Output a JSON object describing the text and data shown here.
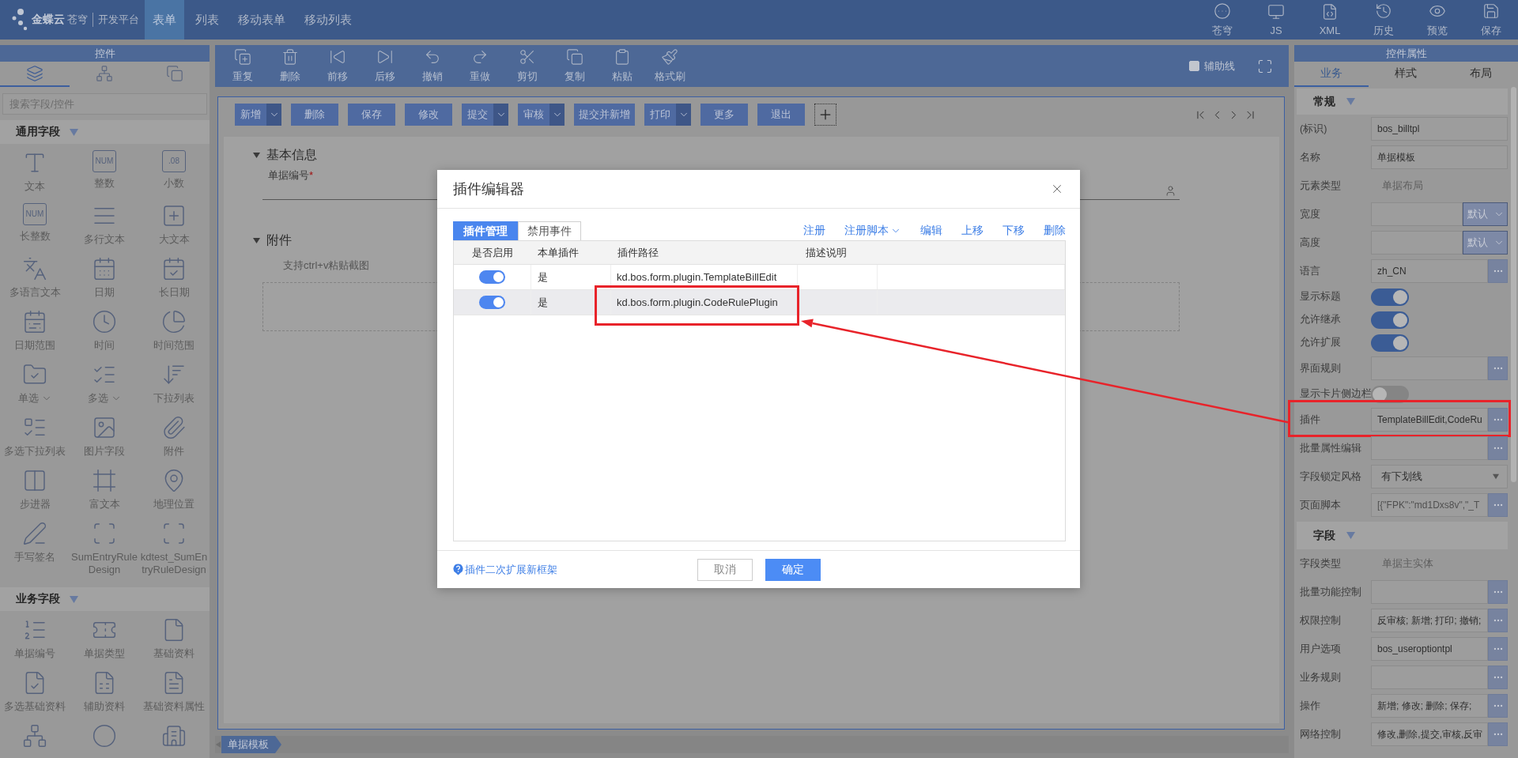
{
  "header": {
    "logo": {
      "brand": "金蝶云",
      "product": "苍穹",
      "platform": "开发平台"
    },
    "tabs": [
      {
        "label": "表单",
        "selected": true
      },
      {
        "label": "列表",
        "selected": false
      },
      {
        "label": "移动表单",
        "selected": false
      },
      {
        "label": "移动列表",
        "selected": false
      }
    ],
    "actions": [
      {
        "label": "苍穹"
      },
      {
        "label": "JS"
      },
      {
        "label": "XML"
      },
      {
        "label": "历史"
      },
      {
        "label": "预览"
      },
      {
        "label": "保存"
      }
    ]
  },
  "controls_panel": {
    "title": "控件",
    "view_tabs": [
      {
        "selected": true
      },
      {
        "selected": false
      },
      {
        "selected": false
      }
    ],
    "search": {
      "placeholder": "搜索字段/控件"
    },
    "groups": [
      {
        "title": "通用字段",
        "expanded": true,
        "items": [
          {
            "label": "文本",
            "dropdown": false
          },
          {
            "label": "整数",
            "icon_text": "NUM",
            "dropdown": false
          },
          {
            "label": "小数",
            "icon_text": ".08",
            "dropdown": false
          },
          {
            "label": "长整数",
            "icon_text": "NUM",
            "dropdown": false
          },
          {
            "label": "多行文本",
            "dropdown": false
          },
          {
            "label": "大文本",
            "dropdown": false
          },
          {
            "label": "多语言文本",
            "dropdown": false
          },
          {
            "label": "日期",
            "dropdown": false
          },
          {
            "label": "长日期",
            "dropdown": false
          },
          {
            "label": "日期范围",
            "dropdown": false
          },
          {
            "label": "时间",
            "dropdown": false
          },
          {
            "label": "时间范围",
            "dropdown": false
          },
          {
            "label": "单选",
            "dropdown": true
          },
          {
            "label": "多选",
            "dropdown": true
          },
          {
            "label": "下拉列表",
            "dropdown": false
          },
          {
            "label": "多选下拉列表",
            "dropdown": false
          },
          {
            "label": "图片字段",
            "dropdown": false
          },
          {
            "label": "附件",
            "dropdown": false
          },
          {
            "label": "步进器",
            "dropdown": false
          },
          {
            "label": "富文本",
            "dropdown": false
          },
          {
            "label": "地理位置",
            "dropdown": false
          },
          {
            "label": "手写签名",
            "dropdown": false
          },
          {
            "label": "SumEntryRuleDesign",
            "dropdown": false
          },
          {
            "label": "kdtest_SumEntryRuleDesign",
            "dropdown": false
          }
        ]
      },
      {
        "title": "业务字段",
        "expanded": true,
        "items": [
          {
            "label": "单据编号",
            "dropdown": false
          },
          {
            "label": "单据类型",
            "dropdown": false
          },
          {
            "label": "基础资料",
            "dropdown": false
          },
          {
            "label": "多选基础资料",
            "dropdown": false
          },
          {
            "label": "辅助资料",
            "dropdown": false
          },
          {
            "label": "基础资料属性",
            "dropdown": false
          },
          {
            "dropdown": false
          },
          {
            "dropdown": false
          },
          {
            "dropdown": false
          }
        ]
      }
    ]
  },
  "canvas": {
    "toolbar": [
      {
        "label": "重复"
      },
      {
        "label": "删除"
      },
      {
        "label": "前移"
      },
      {
        "label": "后移"
      },
      {
        "label": "撤销"
      },
      {
        "label": "重做"
      },
      {
        "label": "剪切"
      },
      {
        "label": "复制"
      },
      {
        "label": "粘贴"
      },
      {
        "label": "格式刷"
      }
    ],
    "guide_lines": {
      "label": "辅助线",
      "checked": false
    },
    "form_buttons": [
      {
        "label": "新增",
        "dropdown": true
      },
      {
        "label": "删除",
        "dropdown": false
      },
      {
        "label": "保存",
        "dropdown": false
      },
      {
        "label": "修改",
        "dropdown": false
      },
      {
        "label": "提交",
        "dropdown": true
      },
      {
        "label": "审核",
        "dropdown": true
      },
      {
        "label": "提交并新增",
        "dropdown": false
      },
      {
        "label": "打印",
        "dropdown": true
      },
      {
        "label": "更多",
        "dropdown": false
      },
      {
        "label": "退出",
        "dropdown": false
      }
    ],
    "sections": [
      {
        "kind": "fields",
        "title": "基本信息",
        "expanded": true,
        "fields": [
          {
            "label": "单据编号",
            "required_marker": "*"
          }
        ]
      },
      {
        "kind": "attachment",
        "title": "附件",
        "expanded": true,
        "hint": "支持ctrl+v粘贴截图"
      }
    ],
    "page_tabs": [
      {
        "label": "单据模板"
      }
    ]
  },
  "properties_panel": {
    "title": "控件属性",
    "tabs": [
      {
        "label": "业务",
        "selected": true
      },
      {
        "label": "样式",
        "selected": false
      },
      {
        "label": "布局",
        "selected": false
      }
    ],
    "sections": [
      {
        "title": "常规",
        "expanded": true,
        "rows": [
          {
            "kind": "input",
            "label": "(标识)",
            "value": "bos_billtpl",
            "highlighted": false
          },
          {
            "kind": "input",
            "label": "名称",
            "value": "单据模板",
            "highlighted": false
          },
          {
            "kind": "static",
            "label": "元素类型",
            "value": "单据布局",
            "highlighted": false
          },
          {
            "kind": "unit",
            "label": "宽度",
            "unit": "默认",
            "highlighted": false
          },
          {
            "kind": "unit",
            "label": "高度",
            "unit": "默认",
            "highlighted": false
          },
          {
            "kind": "lookup",
            "label": "语言",
            "value": "zh_CN",
            "highlighted": false
          },
          {
            "kind": "switch",
            "label": "显示标题",
            "on": true,
            "highlighted": false
          },
          {
            "kind": "switch",
            "label": "允许继承",
            "on": true,
            "highlighted": false
          },
          {
            "kind": "switch",
            "label": "允许扩展",
            "on": true,
            "highlighted": false
          },
          {
            "kind": "lookup",
            "label": "界面规则",
            "highlighted": false
          },
          {
            "kind": "switch",
            "label": "显示卡片侧边栏",
            "on": false,
            "highlighted": false
          },
          {
            "kind": "lookup",
            "label": "插件",
            "value": "TemplateBillEdit,CodeRu",
            "highlighted": true
          },
          {
            "kind": "lookup",
            "label": "批量属性编辑",
            "highlighted": false
          },
          {
            "kind": "select",
            "label": "字段锁定风格",
            "value": "有下划线",
            "highlighted": false
          },
          {
            "kind": "script",
            "label": "页面脚本",
            "value": "[{\"FPK\":\"md1Dxs8v\",\"_T",
            "highlighted": false
          }
        ]
      },
      {
        "title": "字段",
        "expanded": true,
        "rows": [
          {
            "kind": "static",
            "label": "字段类型",
            "value": "单据主实体",
            "highlighted": false
          },
          {
            "kind": "lookup",
            "label": "批量功能控制",
            "highlighted": false
          },
          {
            "kind": "lookup",
            "label": "权限控制",
            "value": "反审核; 新增; 打印; 撤销;",
            "highlighted": false
          },
          {
            "kind": "lookup",
            "label": "用户选项",
            "value": "bos_useroptiontpl",
            "highlighted": false
          },
          {
            "kind": "lookup",
            "label": "业务规则",
            "highlighted": false
          },
          {
            "kind": "lookup",
            "label": "操作",
            "value": "新增; 修改; 删除; 保存;",
            "highlighted": false
          },
          {
            "kind": "lookup",
            "label": "网络控制",
            "value": "修改,删除,提交,审核,反审",
            "highlighted": false
          }
        ]
      }
    ]
  },
  "plugin_editor": {
    "title": "插件编辑器",
    "tabs": [
      {
        "label": "插件管理",
        "selected": true
      },
      {
        "label": "禁用事件",
        "selected": false
      }
    ],
    "actions": [
      {
        "label": "注册",
        "dropdown": false
      },
      {
        "label": "注册脚本",
        "dropdown": true
      },
      {
        "label": "编辑",
        "dropdown": false
      },
      {
        "label": "上移",
        "dropdown": false
      },
      {
        "label": "下移",
        "dropdown": false
      },
      {
        "label": "删除",
        "dropdown": false
      }
    ],
    "columns": [
      "是否启用",
      "本单插件",
      "插件路径",
      "描述说明"
    ],
    "rows": [
      {
        "enabled": true,
        "own": "是",
        "path": "kd.bos.form.plugin.TemplateBillEdit",
        "selected": false,
        "highlighted": false
      },
      {
        "enabled": true,
        "own": "是",
        "path": "kd.bos.form.plugin.CodeRulePlugin",
        "selected": true,
        "highlighted": true
      }
    ],
    "help_link": "插件二次扩展新框架",
    "buttons": [
      {
        "label": "取消",
        "kind": "secondary"
      },
      {
        "label": "确定",
        "kind": "primary"
      }
    ]
  }
}
